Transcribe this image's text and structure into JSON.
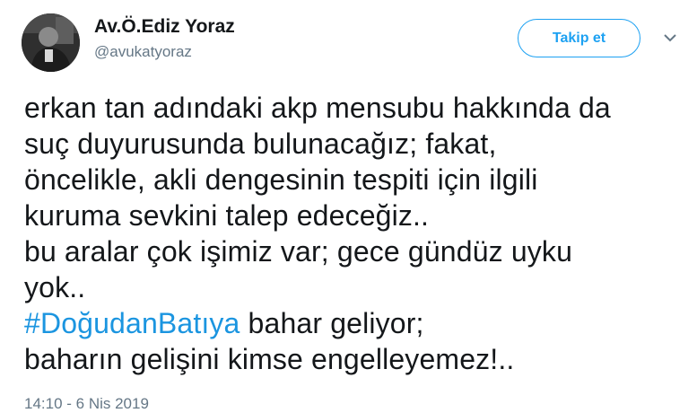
{
  "user": {
    "display_name": "Av.Ö.Ediz Yoraz",
    "handle": "@avukatyoraz"
  },
  "actions": {
    "follow_label": "Takip et"
  },
  "icons": {
    "avatar": "profile-photo",
    "menu": "chevron-down-icon"
  },
  "tweet": {
    "lines": [
      "erkan tan adındaki akp mensubu hakkında da",
      "suç duyurusunda bulunacağız; fakat,",
      "öncelikle, akli dengesinin tespiti için ilgili",
      "kuruma sevkini talep edeceğiz..",
      "bu aralar çok işimiz var; gece gündüz uyku",
      "yok.."
    ],
    "hashtag": "#DoğudanBatıya",
    "hashtag_rest": " bahar geliyor;",
    "last_line": "baharın gelişini kimse engelleyemez!..",
    "timestamp": "14:10 - 6 Nis 2019"
  },
  "colors": {
    "accent": "#1da1f2",
    "hashtag": "#1b95e0",
    "text": "#14171a",
    "secondary": "#657786"
  }
}
